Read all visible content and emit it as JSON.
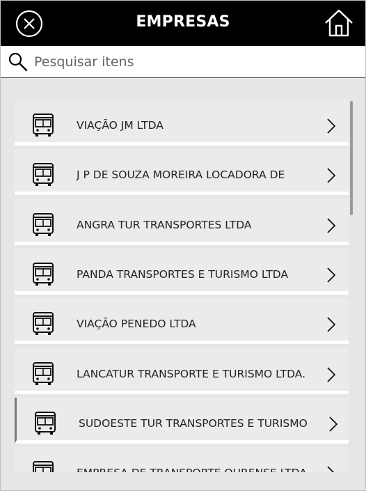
{
  "header": {
    "title": "EMPRESAS",
    "close_icon": "close-circle-icon",
    "home_icon": "home-icon"
  },
  "search": {
    "placeholder": "Pesquisar itens",
    "value": "",
    "icon": "search-icon"
  },
  "list": {
    "item_icon": "bus-icon",
    "item_action_icon": "chevron-right-icon",
    "items": [
      {
        "label": "VIAÇÃO JM LTDA"
      },
      {
        "label": "J P DE SOUZA MOREIRA LOCADORA DE"
      },
      {
        "label": "ANGRA TUR TRANSPORTES LTDA"
      },
      {
        "label": "PANDA TRANSPORTES E TURISMO LTDA"
      },
      {
        "label": "VIAÇÃO PENEDO LTDA"
      },
      {
        "label": "LANCATUR TRANSPORTE E TURISMO LTDA."
      },
      {
        "label": "SUDOESTE TUR TRANSPORTES E TURISMO",
        "selected": true
      },
      {
        "label": "EMPRESA DE TRANSPORTE OURENSE LTDA"
      }
    ]
  },
  "colors": {
    "header_bg": "#000000",
    "list_bg": "#e6e6e6",
    "separator": "#ffffff",
    "selected_marker": "#7a7a7a"
  }
}
